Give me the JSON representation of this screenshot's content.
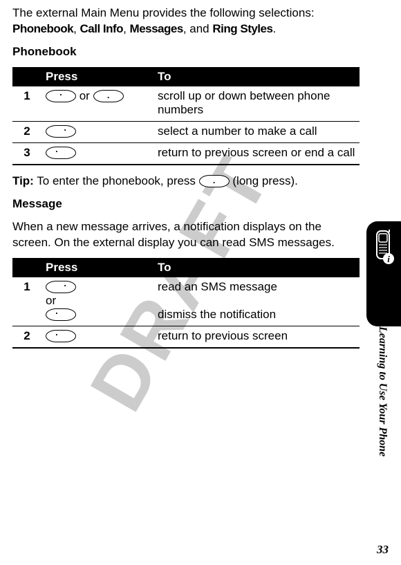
{
  "watermark": "DRAFT",
  "intro": {
    "pre": "The external Main Menu provides the following selections: ",
    "item1": "Phonebook",
    "sep1": ", ",
    "item2": "Call Info",
    "sep2": ", ",
    "item3": "Messages",
    "sep3": ", and ",
    "item4": "Ring Styles",
    "end": "."
  },
  "phonebook_heading": "Phonebook",
  "table_headers": {
    "press": "Press",
    "to": "To"
  },
  "phonebook_rows": {
    "r1": {
      "num": "1",
      "press_mid": " or ",
      "to": "scroll up or down between phone numbers"
    },
    "r2": {
      "num": "2",
      "to": "select a number to make a call"
    },
    "r3": {
      "num": "3",
      "to": "return to previous screen or end a call"
    }
  },
  "tip": {
    "label": "Tip:",
    "pre": " To enter the phonebook, press ",
    "post": " (long press)."
  },
  "message_heading": "Message",
  "message_para": "When a new message arrives, a notification displays on the screen. On the external display you can read SMS messages.",
  "message_rows": {
    "r1": {
      "num": "1",
      "or": "or",
      "to_a": "read an SMS message",
      "to_b": "dismiss the notification"
    },
    "r2": {
      "num": "2",
      "to": "return to previous screen"
    }
  },
  "side_text": "Learning to Use Your Phone",
  "page_number": "33"
}
